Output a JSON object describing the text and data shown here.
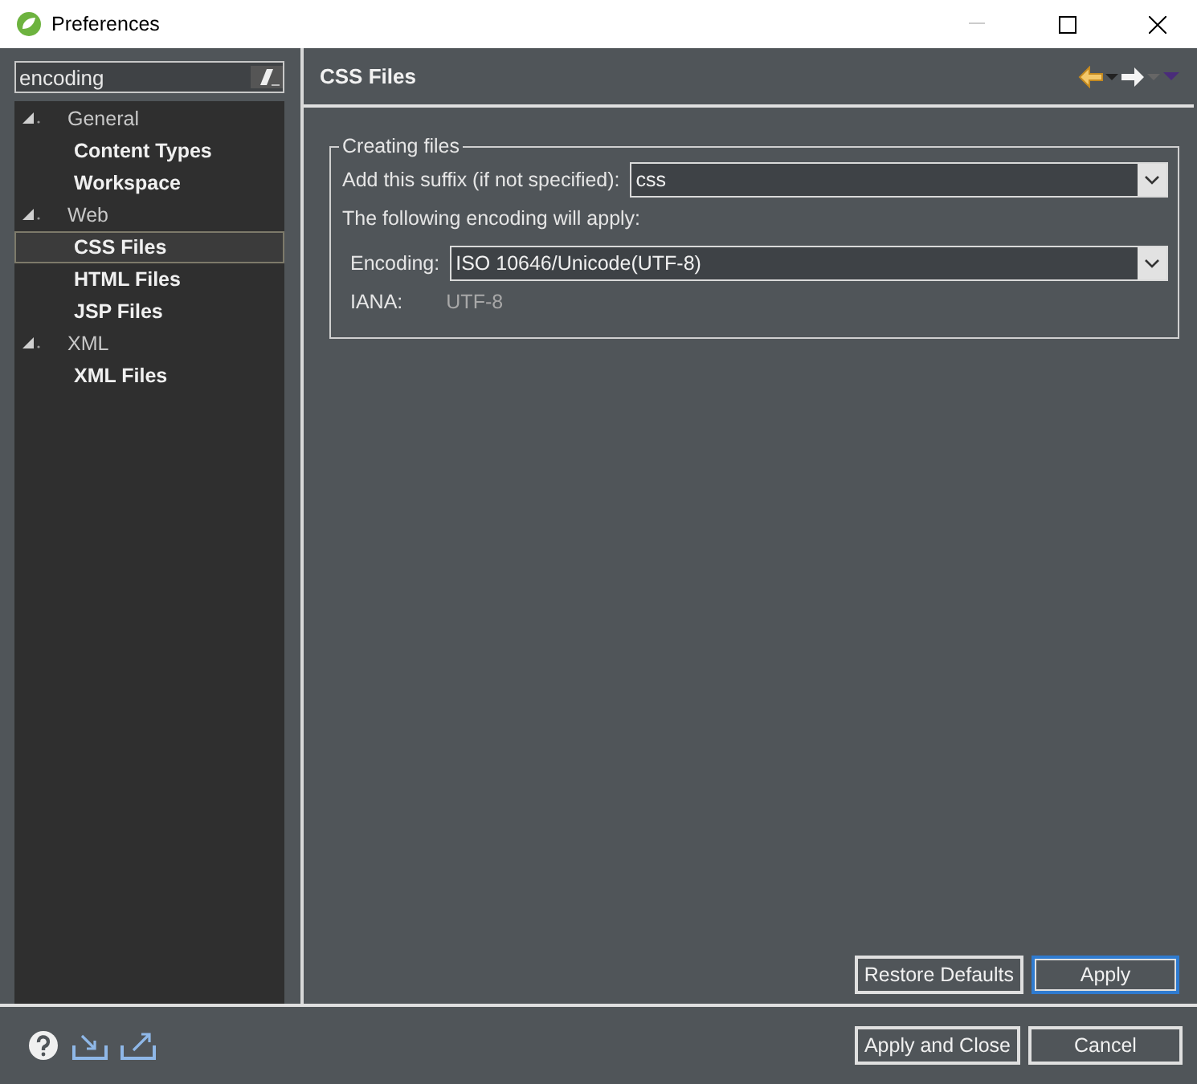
{
  "window": {
    "title": "Preferences"
  },
  "filter": {
    "value": "encoding"
  },
  "tree": [
    {
      "label": "General",
      "expanded": true,
      "selected": false,
      "children": [
        {
          "label": "Content Types",
          "selected": false
        },
        {
          "label": "Workspace",
          "selected": false
        }
      ]
    },
    {
      "label": "Web",
      "expanded": true,
      "selected": false,
      "children": [
        {
          "label": "CSS Files",
          "selected": true
        },
        {
          "label": "HTML Files",
          "selected": false
        },
        {
          "label": "JSP Files",
          "selected": false
        }
      ]
    },
    {
      "label": "XML",
      "expanded": true,
      "selected": false,
      "children": [
        {
          "label": "XML Files",
          "selected": false
        }
      ]
    }
  ],
  "page": {
    "title": "CSS Files",
    "group": {
      "title": "Creating files",
      "suffix_label": "Add this suffix (if not specified):",
      "suffix_value": "css",
      "note": "The following encoding will apply:",
      "encoding_label": "Encoding:",
      "encoding_value": "ISO 10646/Unicode(UTF-8)",
      "iana_label": "IANA:",
      "iana_value": "UTF-8"
    },
    "buttons": [
      {
        "label": "Restore Defaults",
        "focused": false
      },
      {
        "label": "Apply",
        "focused": true
      }
    ]
  },
  "footer_buttons": [
    "Apply and Close",
    "Cancel"
  ]
}
